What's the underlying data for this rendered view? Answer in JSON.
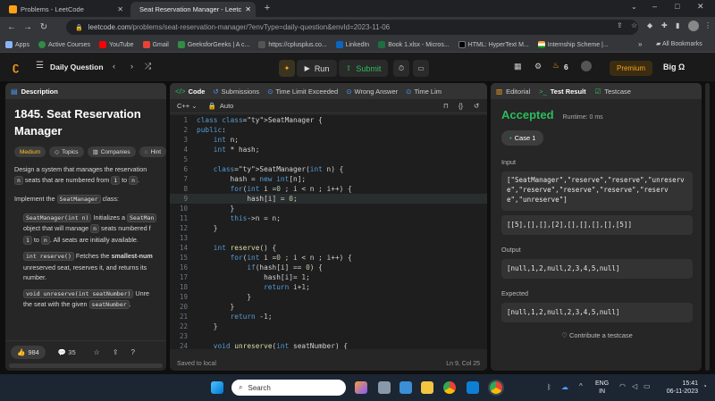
{
  "browser": {
    "tabs": [
      {
        "title": "Problems - LeetCode",
        "active": false
      },
      {
        "title": "Seat Reservation Manager - Leetc",
        "active": true
      }
    ],
    "url_host": "leetcode.com",
    "url_path": "/problems/seat-reservation-manager/?envType=daily-question&envId=2023-11-06",
    "bookmarks": [
      "Apps",
      "Active Courses",
      "YouTube",
      "Gmail",
      "GeeksforGeeks | A c...",
      "https://cplusplus.co...",
      "LinkedIn",
      "Book 1.xlsx - Micros...",
      "HTML: HyperText M...",
      "Internship Scheme |..."
    ],
    "bookmarks_overflow": "»",
    "all_bookmarks": "All Bookmarks"
  },
  "topbar": {
    "nav_label": "Daily Question",
    "run_label": "Run",
    "submit_label": "Submit",
    "streak": "6",
    "premium_label": "Premium",
    "user_label": "Big Ω"
  },
  "description": {
    "tab_label": "Description",
    "title": "1845. Seat Reservation Manager",
    "difficulty": "Medium",
    "tags": [
      "Topics",
      "Companies",
      "Hint"
    ],
    "para1_a": "Design a system that manages the reservation",
    "para1_n": "n",
    "para1_b": " seats that are numbered from ",
    "para1_1": "1",
    "para1_to": " to ",
    "para1_n2": "n",
    "para1_end": ".",
    "para2_a": "Implement the ",
    "para2_code": "SeatManager",
    "para2_b": " class:",
    "bullet1_code": "SeatManager(int n)",
    "bullet1_a": " Initializes a ",
    "bullet1_code2": "SeatMan",
    "bullet1_b": "object that will manage ",
    "bullet1_n": "n",
    "bullet1_c": " seats numbered f",
    "bullet1_1": "1",
    "bullet1_to": " to ",
    "bullet1_n2": "n",
    "bullet1_d": ". All seats are initially available.",
    "bullet2_code": "int reserve()",
    "bullet2_a": " Fetches the ",
    "bullet2_bold": "smallest-num",
    "bullet2_b": "unreserved seat, reserves it, and returns its",
    "bullet2_c": "number.",
    "bullet3_code": "void unreserve(int seatNumber)",
    "bullet3_a": " Unre",
    "bullet3_b": "the seat with the given ",
    "bullet3_code2": "seatNumber",
    "bullet3_c": ".",
    "likes": "984",
    "comments": "35"
  },
  "editor": {
    "tabs": [
      "Code",
      "Submissions",
      "Time Limit Exceeded",
      "Wrong Answer",
      "Time Lim"
    ],
    "language": "C++",
    "mode": "Auto",
    "status_left": "Saved to local",
    "status_right": "Ln 9, Col 25",
    "lines": [
      {
        "n": "1",
        "code": "class SeatManager {"
      },
      {
        "n": "2",
        "code": "public:"
      },
      {
        "n": "3",
        "code": "    int n;"
      },
      {
        "n": "4",
        "code": "    int * hash;"
      },
      {
        "n": "5",
        "code": ""
      },
      {
        "n": "6",
        "code": "    SeatManager(int n) {"
      },
      {
        "n": "7",
        "code": "        hash = new int[n];"
      },
      {
        "n": "8",
        "code": "        for(int i =0 ; i < n ; i++) {"
      },
      {
        "n": "9",
        "code": "            hash[i] = 0;"
      },
      {
        "n": "10",
        "code": "        }"
      },
      {
        "n": "11",
        "code": "        this->n = n;"
      },
      {
        "n": "12",
        "code": "    }"
      },
      {
        "n": "13",
        "code": ""
      },
      {
        "n": "14",
        "code": "    int reserve() {"
      },
      {
        "n": "15",
        "code": "        for(int i =0 ; i < n ; i++) {"
      },
      {
        "n": "16",
        "code": "            if(hash[i] == 0) {"
      },
      {
        "n": "17",
        "code": "                hash[i]= 1;"
      },
      {
        "n": "18",
        "code": "                return i+1;"
      },
      {
        "n": "19",
        "code": "            }"
      },
      {
        "n": "20",
        "code": "        }"
      },
      {
        "n": "21",
        "code": "        return -1;"
      },
      {
        "n": "22",
        "code": "    }"
      },
      {
        "n": "23",
        "code": ""
      },
      {
        "n": "24",
        "code": "    void unreserve(int seatNumber) {"
      },
      {
        "n": "25",
        "code": "        hash[seatNumber-1] = 0;"
      }
    ]
  },
  "result": {
    "tabs": [
      "Editorial",
      "Test Result",
      "Testcase"
    ],
    "verdict": "Accepted",
    "runtime": "Runtime: 0 ms",
    "case_label": "Case 1",
    "input_label": "Input",
    "input1": "[\"SeatManager\",\"reserve\",\"reserve\",\"unreserve\",\"reserve\",\"reserve\",\"reserve\",\"reserve\",\"unreserve\"]",
    "input2": "[[5],[],[],[2],[],[],[],[],[5]]",
    "output_label": "Output",
    "output": "[null,1,2,null,2,3,4,5,null]",
    "expected_label": "Expected",
    "expected": "[null,1,2,null,2,3,4,5,null]",
    "contribute": "Contribute a testcase"
  },
  "taskbar": {
    "search_placeholder": "Search",
    "lang1": "ENG",
    "lang2": "IN",
    "time": "15:41",
    "date": "06-11-2023"
  },
  "colors": {
    "accent": "#ffa116",
    "accepted": "#2cbb5d",
    "run_green": "#2cbb5d"
  }
}
